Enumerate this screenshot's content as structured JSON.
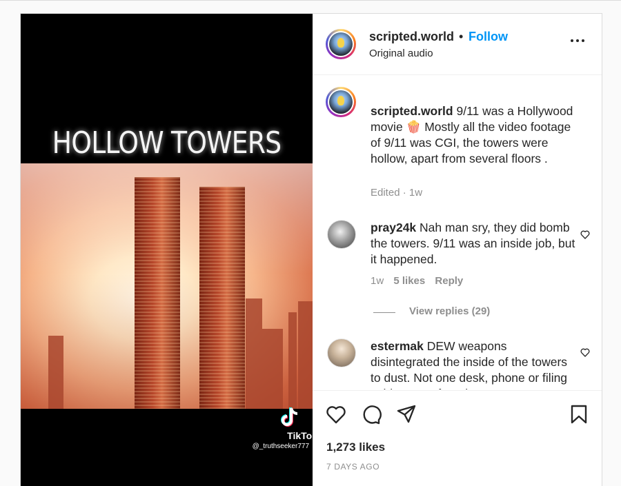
{
  "media": {
    "overlay_title": "HOLLOW TOWERS",
    "watermark_brand": "TikTok",
    "watermark_handle": "@_truthseeker777"
  },
  "header": {
    "username": "scripted.world",
    "separator": "•",
    "follow_label": "Follow",
    "audio_label": "Original audio"
  },
  "caption": {
    "username": "scripted.world",
    "text": "9/11 was a Hollywood movie 🍿 Mostly all the video footage of 9/11 was CGI, the towers were hollow, apart from several floors .",
    "meta": "Edited · 1w"
  },
  "comments": [
    {
      "username": "pray24k",
      "text": "Nah man sry, they did bomb the towers. 9/11 was an inside job, but it happened.",
      "time": "1w",
      "likes": "5 likes",
      "reply_label": "Reply",
      "view_replies": "View replies (29)"
    },
    {
      "username": "estermak",
      "text": "DEW weapons disintegrated the inside of the towers to dust. Not one desk, phone or filing cabinet was found"
    }
  ],
  "footer": {
    "likes": "1,273 likes",
    "time_ago": "7 DAYS AGO"
  },
  "colors": {
    "accent": "#0095f6",
    "text": "#262626",
    "muted": "#8e8e8e"
  },
  "icons": [
    "more-icon",
    "heart-icon",
    "comment-icon",
    "share-icon",
    "bookmark-icon",
    "tiktok-icon"
  ]
}
